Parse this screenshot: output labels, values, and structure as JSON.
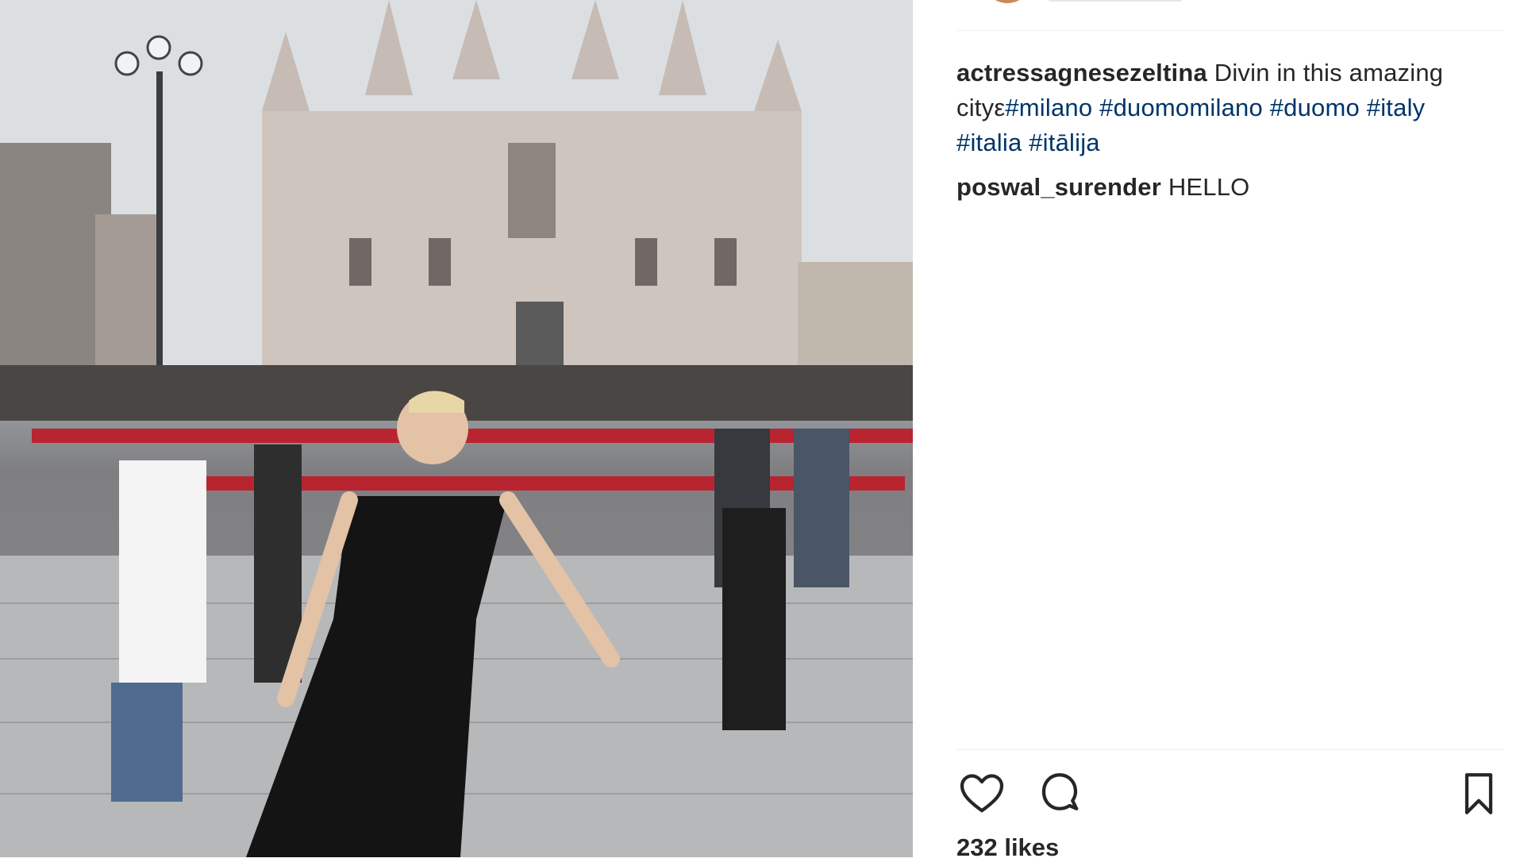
{
  "post": {
    "photo_alt": "Woman posing in front of Milan Cathedral",
    "caption": {
      "username": "actressagnesezeltina",
      "text": "Divin in this amazing city",
      "emoji": "ε",
      "hashtags": [
        "#milano",
        "#duomomilano",
        "#duomo",
        "#italy",
        "#italia",
        "#itālija"
      ]
    },
    "comments": [
      {
        "username": "poswal_surender",
        "text": "HELLO"
      }
    ],
    "actions": {
      "like_icon": "heart-icon",
      "comment_icon": "speech-bubble-icon",
      "save_icon": "bookmark-icon"
    },
    "likes_text": "232 likes"
  },
  "colors": {
    "text": "#262626",
    "hashtag": "#003569",
    "divider": "#efefef"
  }
}
